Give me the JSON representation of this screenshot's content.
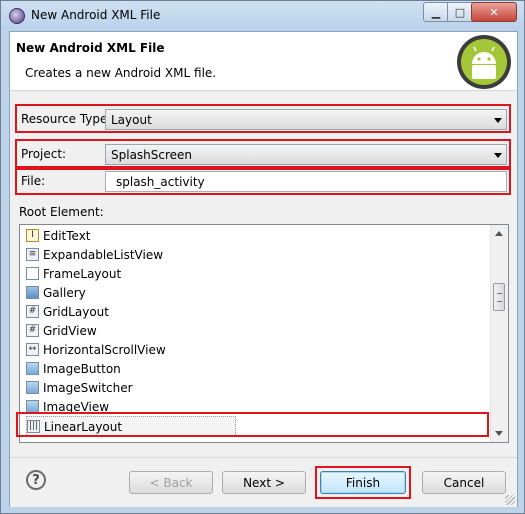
{
  "window": {
    "title": "New Android XML File"
  },
  "header": {
    "title": "New Android XML File",
    "description": "Creates a new Android XML file."
  },
  "form": {
    "resource_type": {
      "label": "Resource Type:",
      "value": "Layout"
    },
    "project": {
      "label": "Project:",
      "value": "SplashScreen"
    },
    "file": {
      "label": "File:",
      "value": "splash_activity"
    },
    "root_element_label": "Root Element:"
  },
  "root_elements": [
    {
      "label": "EditText",
      "icon": "edittext-icon"
    },
    {
      "label": "ExpandableListView",
      "icon": "list-icon"
    },
    {
      "label": "FrameLayout",
      "icon": "frame-icon"
    },
    {
      "label": "Gallery",
      "icon": "gallery-icon"
    },
    {
      "label": "GridLayout",
      "icon": "grid-icon"
    },
    {
      "label": "GridView",
      "icon": "grid-icon"
    },
    {
      "label": "HorizontalScrollView",
      "icon": "hscroll-icon"
    },
    {
      "label": "ImageButton",
      "icon": "image-icon"
    },
    {
      "label": "ImageSwitcher",
      "icon": "image-icon"
    },
    {
      "label": "ImageView",
      "icon": "image-icon"
    },
    {
      "label": "LinearLayout",
      "icon": "linear-layout-icon",
      "selected": true
    }
  ],
  "buttons": {
    "back": "< Back",
    "next": "Next >",
    "finish": "Finish",
    "cancel": "Cancel"
  },
  "colors": {
    "highlight": "#e0141d",
    "accent": "#3c7fb1"
  }
}
